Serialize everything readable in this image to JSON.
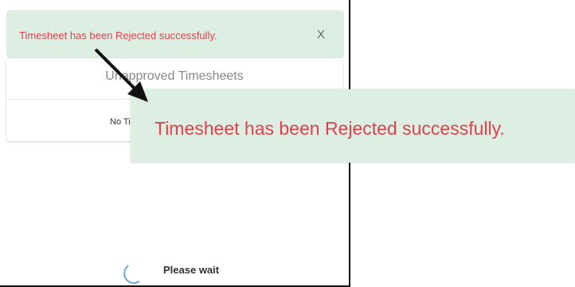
{
  "toast": {
    "message": "Timesheet has been Rejected successfully.",
    "close_label": "X"
  },
  "card": {
    "title": "Unapproved Timesheets",
    "empty_text": "No Timesheets"
  },
  "loading": {
    "label": "Please wait"
  },
  "callout": {
    "message": "Timesheet has been Rejected successfully."
  },
  "colors": {
    "toast_bg": "#dcefe2",
    "toast_text": "#e0424b",
    "spinner": "#6fa8d3"
  },
  "icons": {
    "arrow": "arrow-icon",
    "spinner": "spinner-icon"
  }
}
